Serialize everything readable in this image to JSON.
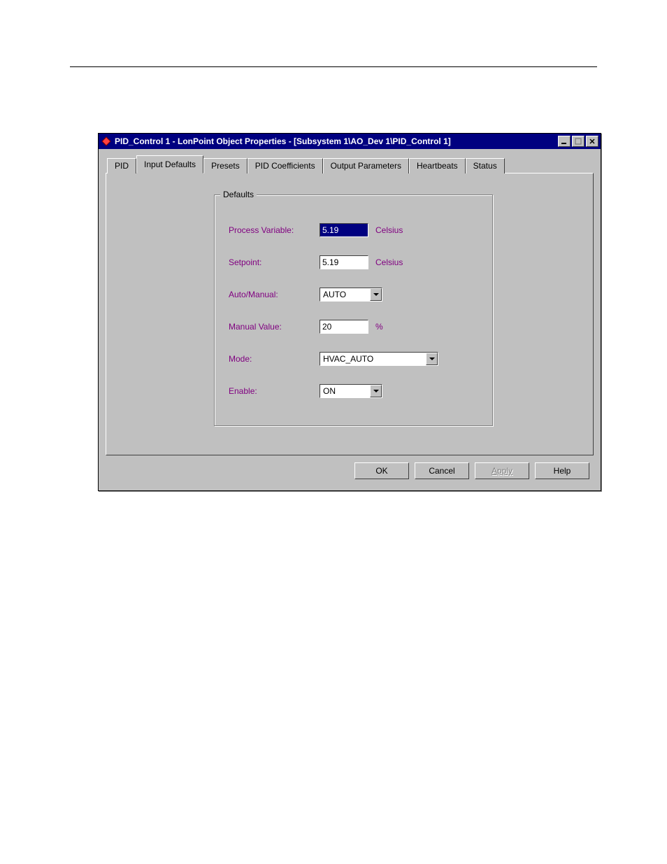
{
  "window": {
    "title": "PID_Control 1 - LonPoint Object Properties - [Subsystem 1\\AO_Dev 1\\PID_Control 1]"
  },
  "tabs": [
    {
      "label": "PID"
    },
    {
      "label": "Input Defaults"
    },
    {
      "label": "Presets"
    },
    {
      "label": "PID Coefficients"
    },
    {
      "label": "Output Parameters"
    },
    {
      "label": "Heartbeats"
    },
    {
      "label": "Status"
    }
  ],
  "group": {
    "legend": "Defaults"
  },
  "fields": {
    "process_variable": {
      "label": "Process Variable:",
      "value": "5.19",
      "unit": "Celsius"
    },
    "setpoint": {
      "label": "Setpoint:",
      "value": "5.19",
      "unit": "Celsius"
    },
    "auto_manual": {
      "label": "Auto/Manual:",
      "value": "AUTO"
    },
    "manual_value": {
      "label": "Manual Value:",
      "value": "20",
      "unit": "%"
    },
    "mode": {
      "label": "Mode:",
      "value": "HVAC_AUTO"
    },
    "enable": {
      "label": "Enable:",
      "value": "ON"
    }
  },
  "buttons": {
    "ok": "OK",
    "cancel": "Cancel",
    "apply": "Apply",
    "help": "Help"
  }
}
